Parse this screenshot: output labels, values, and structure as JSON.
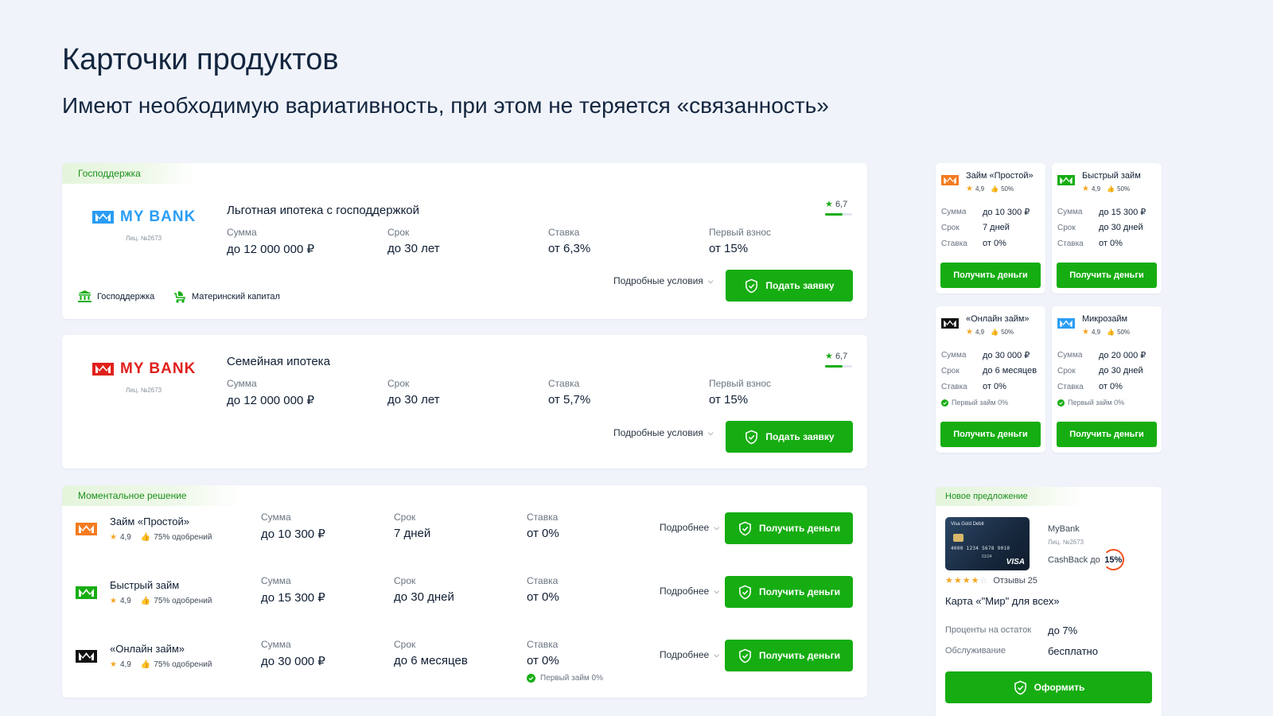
{
  "header": {
    "title": "Карточки продуктов",
    "subtitle": "Имеют необходимую вариативность, при этом не теряется «связанность»"
  },
  "colors": {
    "accent": "#16ad12",
    "blue_logo": "#2a9df4",
    "red_logo": "#e0201b",
    "orange_logo": "#f47b20"
  },
  "mortgages": [
    {
      "tag": "Господдержка",
      "bank_name": "MY BANK",
      "license": "Лиц. №2673",
      "title": "Льготная ипотека с господдержкой",
      "rating": "6,7",
      "sum_label": "Сумма",
      "sum_value": "до 12 000 000 ₽",
      "term_label": "Срок",
      "term_value": "до 30 лет",
      "rate_label": "Ставка",
      "rate_value": "от 6,3%",
      "down_label": "Первый взнос",
      "down_value": "от 15%",
      "features": [
        "Господдержка",
        "Материнский капитал"
      ],
      "details_label": "Подробные условия",
      "button_label": "Подать заявку"
    },
    {
      "bank_name": "MY BANK",
      "license": "Лиц. №2673",
      "title": "Семейная ипотека",
      "rating": "6,7",
      "sum_label": "Сумма",
      "sum_value": "до 12 000 000 ₽",
      "term_label": "Срок",
      "term_value": "до 30 лет",
      "rate_label": "Ставка",
      "rate_value": "от 5,7%",
      "down_label": "Первый взнос",
      "down_value": "от 15%",
      "details_label": "Подробные условия",
      "button_label": "Подать заявку"
    }
  ],
  "loans": {
    "tag": "Моментальное решение",
    "items": [
      {
        "title": "Займ «Простой»",
        "rating": "4,9",
        "approval": "75% одобрений",
        "sum_label": "Сумма",
        "sum_value": "до 10 300 ₽",
        "term_label": "Срок",
        "term_value": "7 дней",
        "rate_label": "Ставка",
        "rate_value": "от 0%",
        "details_label": "Подробнее",
        "button_label": "Получить деньги"
      },
      {
        "title": "Быстрый займ",
        "rating": "4,9",
        "approval": "75% одобрений",
        "sum_label": "Сумма",
        "sum_value": "до 15 300 ₽",
        "term_label": "Срок",
        "term_value": "до 30 дней",
        "rate_label": "Ставка",
        "rate_value": "от 0%",
        "details_label": "Подробнее",
        "button_label": "Получить деньги"
      },
      {
        "title": "«Онлайн займ»",
        "rating": "4,9",
        "approval": "75% одобрений",
        "sum_label": "Сумма",
        "sum_value": "до 30 000 ₽",
        "term_label": "Срок",
        "term_value": "до 6 месяцев",
        "rate_label": "Ставка",
        "rate_value": "от 0%",
        "note": "Первый займ 0%",
        "details_label": "Подробнее",
        "button_label": "Получить деньги"
      }
    ]
  },
  "mini_cards": [
    {
      "title": "Займ «Простой»",
      "rating": "4,9",
      "approval": "50%",
      "rows": [
        [
          "Сумма",
          "до 10 300 ₽"
        ],
        [
          "Срок",
          "7 дней"
        ],
        [
          "Ставка",
          "от 0%"
        ]
      ],
      "button_label": "Получить деньги"
    },
    {
      "title": "Быстрый займ",
      "rating": "4,9",
      "approval": "50%",
      "rows": [
        [
          "Сумма",
          "до 15 300 ₽"
        ],
        [
          "Срок",
          "до 30 дней"
        ],
        [
          "Ставка",
          "от 0%"
        ]
      ],
      "button_label": "Получить деньги"
    },
    {
      "title": "«Онлайн займ»",
      "rating": "4,9",
      "approval": "50%",
      "rows": [
        [
          "Сумма",
          "до 30 000 ₽"
        ],
        [
          "Срок",
          "до 6 месяцев"
        ],
        [
          "Ставка",
          "от 0%"
        ]
      ],
      "note": "Первый займ 0%",
      "button_label": "Получить деньги"
    },
    {
      "title": "Микрозайм",
      "rating": "4,9",
      "approval": "50%",
      "rows": [
        [
          "Сумма",
          "до 20 000 ₽"
        ],
        [
          "Срок",
          "до 30 дней"
        ],
        [
          "Ставка",
          "от 0%"
        ]
      ],
      "note": "Первый займ 0%",
      "button_label": "Получить деньги"
    }
  ],
  "offer": {
    "tag": "Новое предложение",
    "card_brand": "Visa Gold Debit",
    "card_number": "4000 1234 5678 9010",
    "card_expiry": "01/24",
    "card_network": "VISA",
    "bank": "MyBank",
    "license": "Лиц. №2673",
    "cashback_label": "CashBack до",
    "cashback_value": "15%",
    "stars": 4,
    "reviews": "Отзывы 25",
    "title": "Карта «\"Мир\" для всех»",
    "interest_label": "Проценты на остаток",
    "interest_value": "до 7%",
    "service_label": "Обслуживание",
    "service_value": "бесплатно",
    "button_label": "Оформить"
  }
}
